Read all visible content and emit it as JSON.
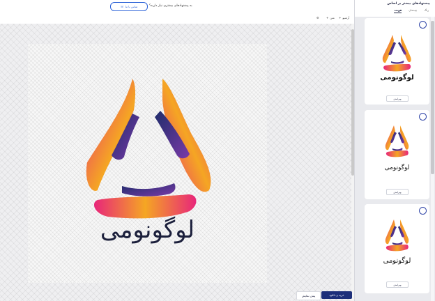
{
  "topbar": {
    "help_text": "به پیشنهادهای بیشتری نیاز دارید؟",
    "contact_label": "تماس با ما"
  },
  "toolbar": {
    "history_label": "آرشیو",
    "text_label": "متن",
    "layout_label": "چیدمان"
  },
  "logo": {
    "text": "لوگونومی",
    "colors": {
      "orange": "#f39a24",
      "magenta": "#e8267a",
      "purple": "#7a3aa8",
      "navy": "#1f2d6b"
    }
  },
  "actions": {
    "buy_label": "خرید و دانلود",
    "preview_label": "پیش نمایش"
  },
  "panel": {
    "title": "پیشنهادهای بیشتر بر اساس",
    "tabs": [
      "رنگ",
      "چیدمان",
      "فونت"
    ],
    "active_tab": "فونت",
    "cards": [
      {
        "text": "لوگونومی",
        "edit_label": "ویرایش"
      },
      {
        "text": "لوگونومی",
        "edit_label": "ویرایش"
      },
      {
        "text": "لوگونومی",
        "edit_label": "ویرایش"
      }
    ]
  }
}
